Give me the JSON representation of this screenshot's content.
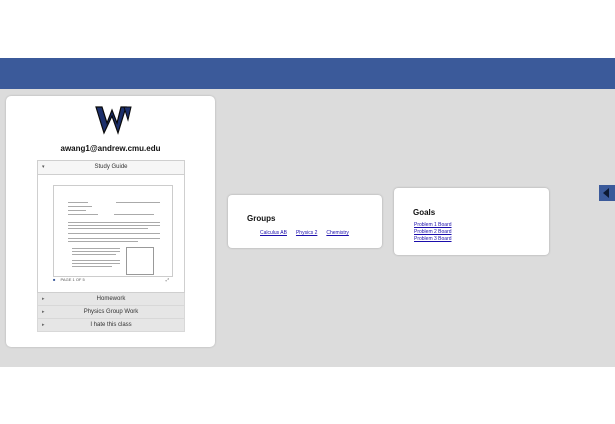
{
  "profile": {
    "email": "awang1@andrew.cmu.edu",
    "accordion": {
      "open_label": "Study Guide",
      "page_indicator": "PAGE 1 OF 5",
      "items": [
        {
          "label": "Homework"
        },
        {
          "label": "Physics Group Work"
        },
        {
          "label": "I hate this class"
        }
      ]
    }
  },
  "groups": {
    "title": "Groups",
    "links": [
      "Calculus AB",
      "Physics 2",
      "Chemistry"
    ]
  },
  "goals": {
    "title": "Goals",
    "links": [
      "Problem 1 Board",
      "Problem 2 Board",
      "Problem 3 Board"
    ]
  },
  "colors": {
    "topbar": "#3b5a9a",
    "background": "#dcdcdc",
    "link": "#1a0dab"
  },
  "icons": {
    "logo": "w-logo-icon",
    "collapse": "chevron-left-icon"
  }
}
